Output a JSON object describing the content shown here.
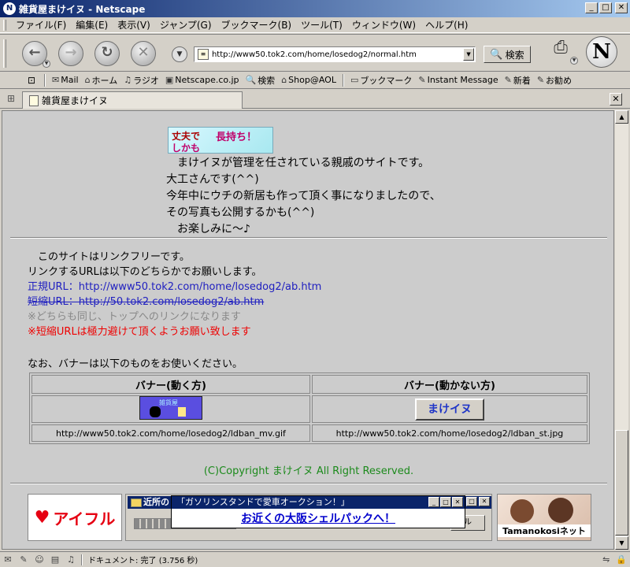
{
  "window": {
    "title": "雑貨屋まけイヌ - Netscape"
  },
  "menu": [
    "ファイル(F)",
    "編集(E)",
    "表示(V)",
    "ジャンプ(G)",
    "ブックマーク(B)",
    "ツール(T)",
    "ウィンドウ(W)",
    "ヘルプ(H)"
  ],
  "nav": {
    "url": "http://www50.tok2.com/home/losedog2/normal.htm",
    "search_label": "検索"
  },
  "personal_toolbar": [
    "Mail",
    "ホーム",
    "ラジオ",
    "Netscape.co.jp",
    "検索",
    "Shop@AOL",
    "ブックマーク",
    "Instant Message",
    "新着",
    "お勧め"
  ],
  "tab": {
    "label": "雑貨屋まけイヌ"
  },
  "page": {
    "top_banner": {
      "line1": "丈夫で",
      "line2": "長持ち！",
      "line3": "しかも"
    },
    "intro": [
      "　まけイヌが管理を任されている親戚のサイトです。",
      "大工さんです(^^)",
      "今年中にウチの新居も作って頂く事になりましたので、",
      "その写真も公開するかも(^^)",
      "　お楽しみに～♪"
    ],
    "link_free": "　このサイトはリンクフリーです。",
    "link_request": "リンクするURLは以下のどちらかでお願いします。",
    "normal_url": "正規URL：http://www50.tok2.com/home/losedog2/ab.htm",
    "short_url": "短縮URL：http://50.tok2.com/losedog2/ab.htm",
    "note_same": "※どちらも同じ、トップへのリンクになります",
    "note_avoid": "※短縮URLは極力避けて頂くようお願い致します",
    "banner_note": "なお、バナーは以下のものをお使いください。",
    "banner_table": {
      "headers": [
        "バナー(動く方)",
        "バナー(動かない方)"
      ],
      "moving_banner_text": "雑貨屋",
      "still_banner_text": "まけイヌ",
      "urls": [
        "http://www50.tok2.com/home/losedog2/ldban_mv.gif",
        "http://www50.tok2.com/home/losedog2/ldban_st.jpg"
      ]
    },
    "copyright": "(C)Copyright まけイヌ All Right Reserved."
  },
  "ads": {
    "aiful": "アイフル",
    "mid_title": "近所の",
    "mid_button": "ル",
    "popup_title": "「ガソリンスタンドで愛車オークション！」",
    "popup_link": "お近くの大阪シェルパックへ！",
    "tamanokosi": "Tamanokosiネット"
  },
  "status": {
    "text": "ドキュメント: 完了 (3.756 秒)"
  },
  "colors": {
    "title_bar": "#0a246a",
    "link_blue": "#2020c0",
    "note_red": "#e00000",
    "copyright_green": "#1c8a1c",
    "aiful_red": "#e60012"
  }
}
